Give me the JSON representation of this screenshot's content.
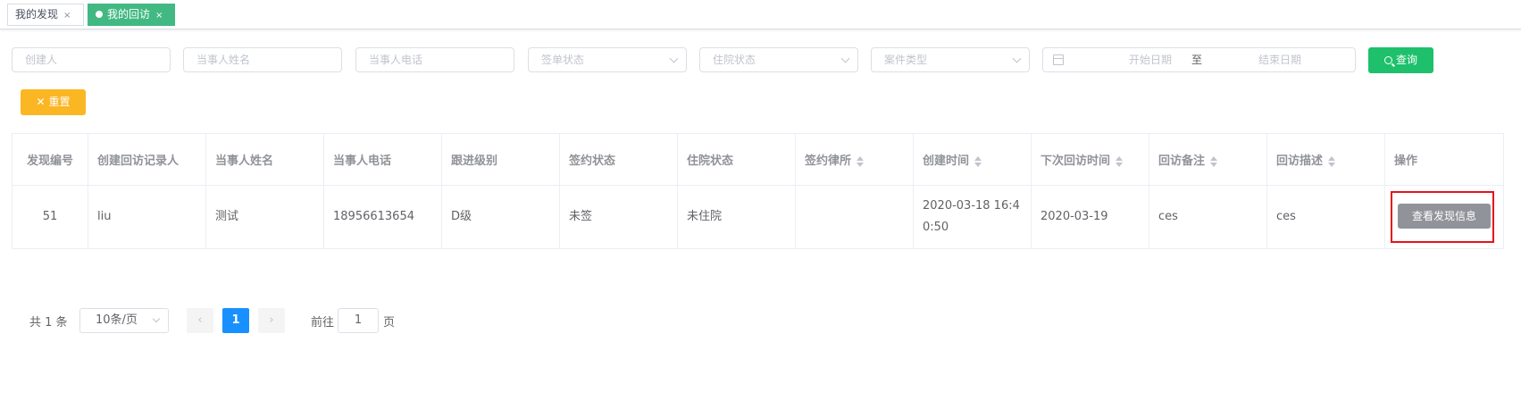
{
  "tabs": [
    {
      "label": "我的发现",
      "close": "×",
      "active": false
    },
    {
      "label": "我的回访",
      "close": "×",
      "active": true
    }
  ],
  "filters": {
    "creator_placeholder": "创建人",
    "party_name_placeholder": "当事人姓名",
    "party_phone_placeholder": "当事人电话",
    "sign_status_placeholder": "签单状态",
    "hospital_status_placeholder": "住院状态",
    "case_type_placeholder": "案件类型",
    "start_date_placeholder": "开始日期",
    "date_separator": "至",
    "end_date_placeholder": "结束日期",
    "search_label": "查询",
    "reset_label": "重置"
  },
  "table": {
    "headers": [
      "发现编号",
      "创建回访记录人",
      "当事人姓名",
      "当事人电话",
      "跟进级别",
      "签约状态",
      "住院状态",
      "签约律所",
      "创建时间",
      "下次回访时间",
      "回访备注",
      "回访描述",
      "操作"
    ],
    "rows": [
      {
        "id": "51",
        "creator": "liu",
        "party_name": "测试",
        "party_phone": "18956613654",
        "level": "D级",
        "sign_status": "未签",
        "hospital_status": "未住院",
        "law_firm": "",
        "created_time": "2020-03-18 16:40:50",
        "next_visit": "2020-03-19",
        "remark": "ces",
        "description": "ces",
        "action_label": "查看发现信息"
      }
    ]
  },
  "pagination": {
    "total": "共 1 条",
    "page_size": "10条/页",
    "prev": "‹",
    "next": "›",
    "current_page": "1",
    "goto_prefix": "前往",
    "goto_value": "1",
    "goto_suffix": "页"
  }
}
